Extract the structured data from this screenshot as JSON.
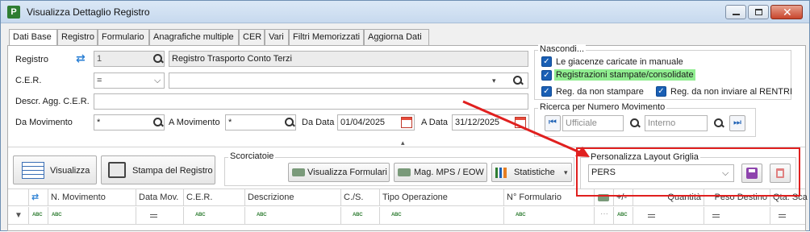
{
  "window": {
    "title": "Visualizza Dettaglio Registro"
  },
  "tabs": [
    "Dati Base",
    "Registro",
    "Formulario",
    "Anagrafiche multiple",
    "CER",
    "Vari",
    "Filtri Memorizzati",
    "Aggiorna Dati"
  ],
  "form": {
    "registro_label": "Registro",
    "registro_code": "1",
    "registro_name": "Registro Trasporto Conto Terzi",
    "cer_label": "C.E.R.",
    "cer_operator": "=",
    "cer_value": "",
    "descr_label": "Descr. Agg. C.E.R.",
    "descr_value": "",
    "da_mov_label": "Da Movimento",
    "da_mov_value": "*",
    "a_mov_label": "A Movimento",
    "a_mov_value": "*",
    "da_data_label": "Da Data",
    "da_data_value": "01/04/2025",
    "a_data_label": "A Data",
    "a_data_value": "31/12/2025"
  },
  "nascondi": {
    "title": "Nascondi...",
    "items": [
      {
        "label": "Le giacenze caricate in manuale",
        "checked": true
      },
      {
        "label": "Registrazioni stampate/consolidate",
        "checked": true
      },
      {
        "label": "Reg. da non stampare",
        "checked": true
      },
      {
        "label": "Reg. da non inviare al RENTRI",
        "checked": true
      }
    ]
  },
  "ricerca": {
    "title": "Ricerca per Numero Movimento",
    "ufficiale_placeholder": "Ufficiale",
    "interno_placeholder": "Interno"
  },
  "toolbar": {
    "visualizza": "Visualizza",
    "stampa": "Stampa del Registro",
    "scorciatoie_title": "Scorciatoie",
    "visualizza_formulari": "Visualizza Formulari",
    "mag_mps": "Mag. MPS / EOW",
    "statistiche": "Statistiche"
  },
  "layout": {
    "title": "Personalizza Layout Griglia",
    "value": "PERS"
  },
  "grid": {
    "columns": [
      "N. Movimento",
      "Data Mov.",
      "C.E.R.",
      "Descrizione",
      "C./S.",
      "Tipo Operazione",
      "N° Formulario",
      "+/-",
      "Quantità",
      "Peso Destino",
      "Qta. Sca"
    ],
    "filter_abc": "ABC"
  },
  "colors": {
    "highlight": "#90ee90",
    "annotation": "#e0201f",
    "checkbox": "#1a5fb4"
  }
}
